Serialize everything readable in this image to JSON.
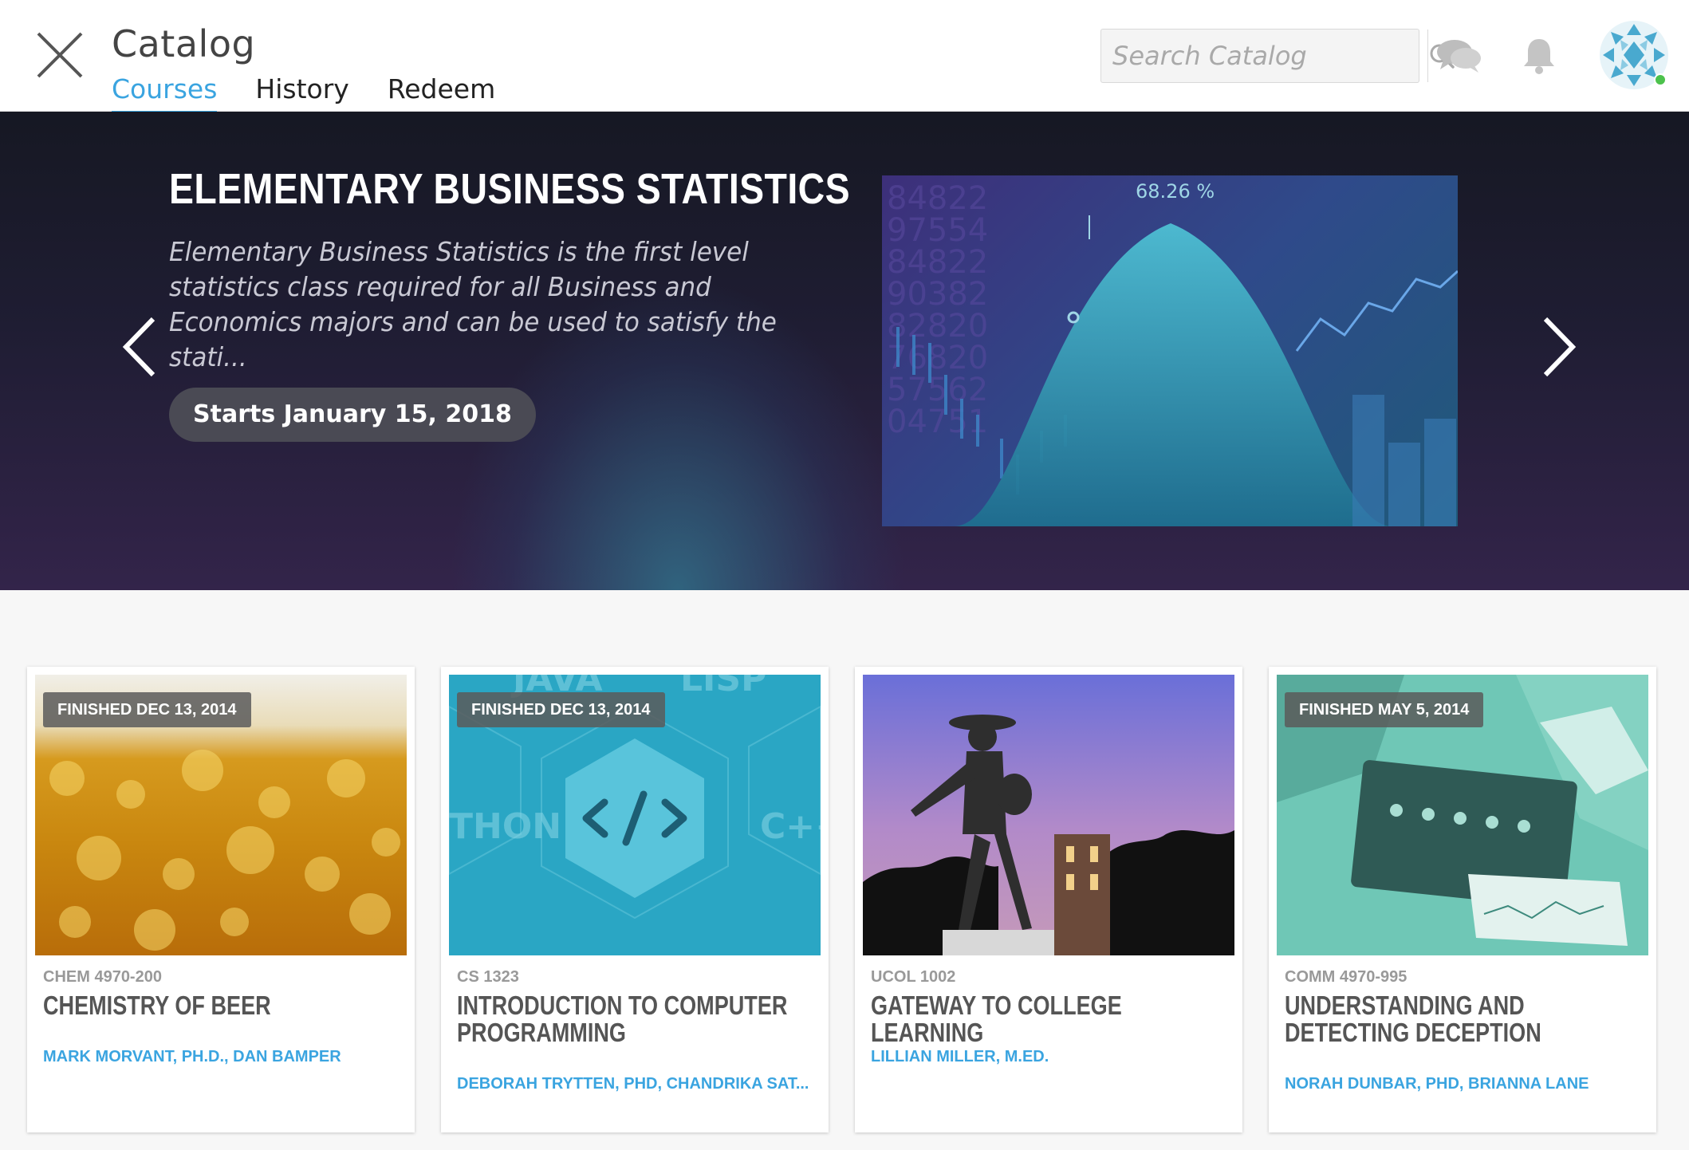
{
  "header": {
    "title": "Catalog",
    "tabs": [
      {
        "label": "Courses",
        "active": true
      },
      {
        "label": "History",
        "active": false
      },
      {
        "label": "Redeem",
        "active": false
      }
    ],
    "search": {
      "placeholder": "Search Catalog",
      "value": ""
    },
    "icons": [
      "close-icon",
      "search-icon",
      "chat-icon",
      "bell-icon",
      "avatar"
    ]
  },
  "hero": {
    "title": "ELEMENTARY BUSINESS STATISTICS",
    "description": "Elementary Business Statistics is the first level statistics class required for all Business and Economics majors and can be used to satisfy the stati...",
    "start_label": "Starts January 15, 2018",
    "image_caption": "68.26 %"
  },
  "courses": [
    {
      "badge": "FINISHED DEC 13, 2014",
      "code": "CHEM 4970-200",
      "title": "CHEMISTRY OF BEER",
      "instructors": "MARK MORVANT, PH.D., DAN BAMPER"
    },
    {
      "badge": "FINISHED DEC 13, 2014",
      "code": "CS 1323",
      "title": "INTRODUCTION TO COMPUTER PROGRAMMING",
      "instructors": "DEBORAH TRYTTEN, PHD, CHANDRIKA SAT..."
    },
    {
      "badge": "",
      "code": "UCOL 1002",
      "title": "GATEWAY TO COLLEGE LEARNING",
      "instructors": "LILLIAN MILLER, M.ED."
    },
    {
      "badge": "FINISHED MAY 5, 2014",
      "code": "COMM 4970-995",
      "title": "UNDERSTANDING AND DETECTING DECEPTION",
      "instructors": "NORAH DUNBAR, PHD, BRIANNA LANE"
    }
  ],
  "colors": {
    "accent": "#3aa4e0",
    "status_online": "#4cc24c"
  }
}
